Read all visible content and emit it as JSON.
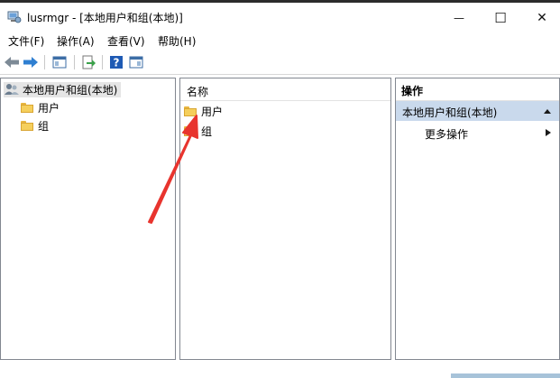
{
  "window": {
    "title": "lusrmgr - [本地用户和组(本地)]",
    "controls": {
      "minimize": "—",
      "maximize": "☐",
      "close": "✕"
    }
  },
  "menu": {
    "file": "文件(F)",
    "action": "操作(A)",
    "view": "查看(V)",
    "help": "帮助(H)"
  },
  "toolbar": {
    "icons": [
      "back-arrow-icon",
      "forward-arrow-icon",
      "show-hide-tree-icon",
      "export-list-icon",
      "help-icon",
      "show-action-pane-icon"
    ]
  },
  "tree": {
    "root": "本地用户和组(本地)",
    "items": [
      "用户",
      "组"
    ]
  },
  "list": {
    "column_name": "名称",
    "items": [
      "用户",
      "组"
    ]
  },
  "actions": {
    "header": "操作",
    "section": "本地用户和组(本地)",
    "more": "更多操作"
  },
  "colors": {
    "selection": "#c9d9ec",
    "pane_border": "#828790",
    "annotation_arrow": "#e8342e"
  }
}
